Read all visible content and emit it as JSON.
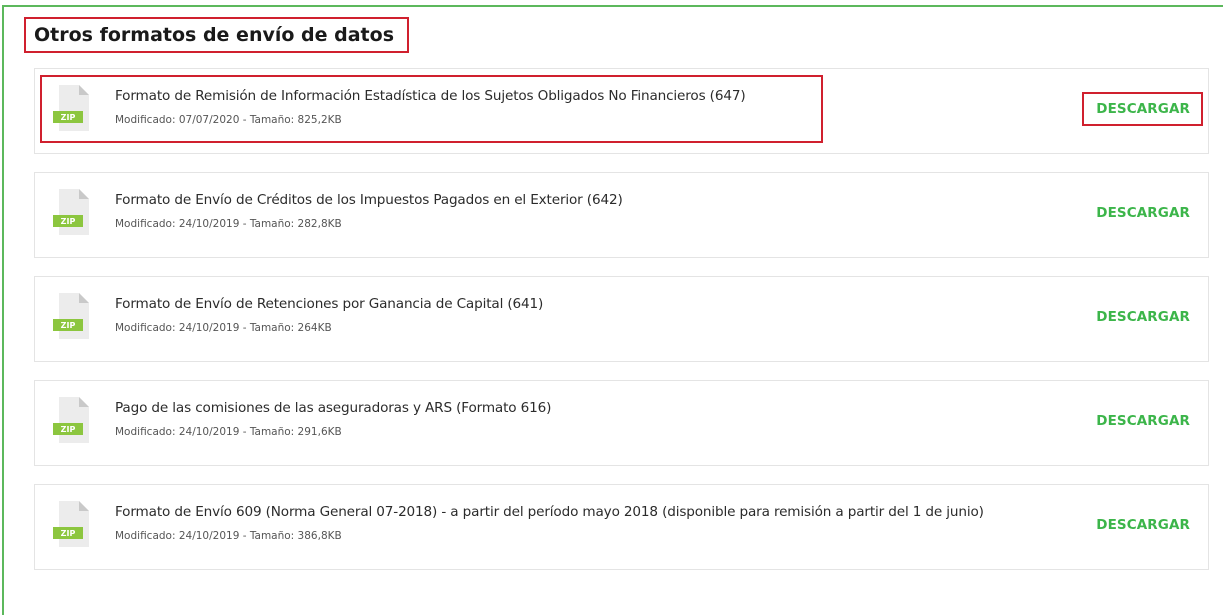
{
  "section": {
    "title": "Otros formatos de envío de datos"
  },
  "icon_colors": {
    "page": "#ececec",
    "fold": "#c9c9c9",
    "badge": "#8cc63f"
  },
  "download_color": "#3cb54a",
  "highlight_color": "#d0202e",
  "files": [
    {
      "icon": "zip-file-icon",
      "badge": "ZIP",
      "title": "Formato de Remisión de Información Estadística de los Sujetos Obligados No Financieros (647)",
      "meta": "Modificado: 07/07/2020 - Tamaño: 825,2KB",
      "action": "DESCARGAR"
    },
    {
      "icon": "zip-file-icon",
      "badge": "ZIP",
      "title": "Formato de Envío de Créditos de los Impuestos Pagados en el Exterior (642)",
      "meta": "Modificado: 24/10/2019 - Tamaño: 282,8KB",
      "action": "DESCARGAR"
    },
    {
      "icon": "zip-file-icon",
      "badge": "ZIP",
      "title": "Formato de Envío de Retenciones por Ganancia de Capital (641)",
      "meta": "Modificado: 24/10/2019 - Tamaño: 264KB",
      "action": "DESCARGAR"
    },
    {
      "icon": "zip-file-icon",
      "badge": "ZIP",
      "title": "Pago de las comisiones de las aseguradoras y ARS (Formato 616)",
      "meta": "Modificado: 24/10/2019 - Tamaño: 291,6KB",
      "action": "DESCARGAR"
    },
    {
      "icon": "zip-file-icon",
      "badge": "ZIP",
      "title": "Formato de Envío 609 (Norma General 07-2018) - a partir del período mayo 2018 (disponible para remisión a partir del 1 de junio)",
      "meta": "Modificado: 24/10/2019 - Tamaño: 386,8KB",
      "action": "DESCARGAR"
    }
  ]
}
